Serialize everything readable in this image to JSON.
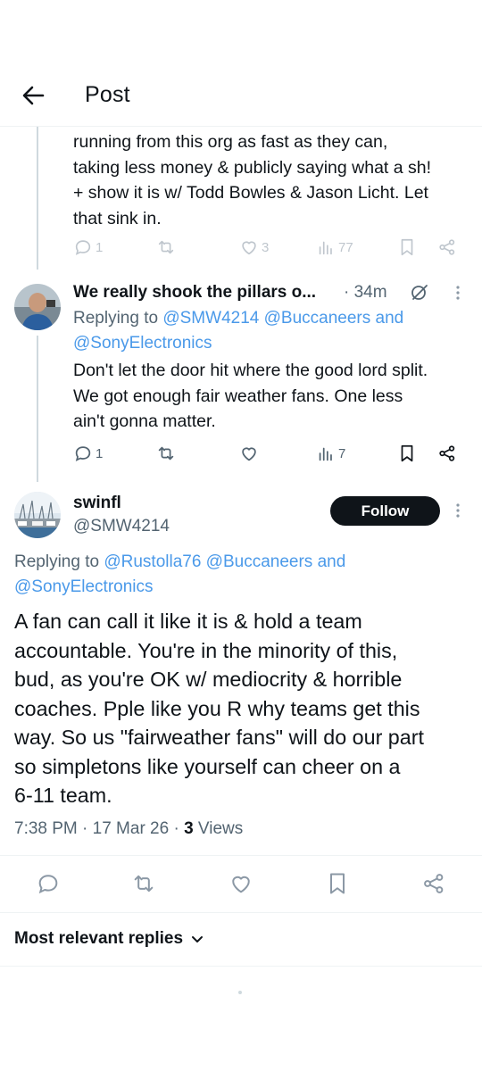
{
  "header": {
    "title": "Post"
  },
  "prev_tweet": {
    "text_lines": [
      "running from this org as fast as they can,",
      "taking less money & publicly saying what a sh!",
      "+ show it is w/ Todd Bowles & Jason Licht. Let",
      "that sink in."
    ],
    "replies": "1",
    "likes": "3",
    "views": "77"
  },
  "reply_tweet": {
    "name": "We really shook the pillars o...",
    "time": "· 34m",
    "replying_prefix": "Replying to ",
    "replying_line1_mentions": "@SMW4214 @Buccaneers and",
    "replying_line2_mentions": "@SonyElectronics",
    "text_lines": [
      "Don't let the door hit where the good lord split.",
      "We got enough fair weather fans. One less",
      "ain't gonna matter."
    ],
    "replies": "1",
    "views": "7"
  },
  "main_tweet": {
    "name": "swinfl",
    "handle": "@SMW4214",
    "follow_label": "Follow",
    "replying_prefix": "Replying to ",
    "replying_line1_mentions": "@Rustolla76 @Buccaneers and",
    "replying_line2_mentions": "@SonyElectronics",
    "text_lines": [
      "A fan can call it like it is & hold a team",
      "accountable.  You're in the minority of this,",
      "bud, as you're OK w/ mediocrity & horrible",
      "coaches.  Pple like you R why teams get this",
      "way. So us \"fairweather fans\" will do our part",
      "so simpletons like yourself can cheer on a",
      "6-11 team."
    ],
    "timestamp": "7:38 PM · 17 Mar 26 · ",
    "views_count": "3",
    "views_label": " Views"
  },
  "replies_sort": {
    "label": "Most relevant replies"
  },
  "colors": {
    "link": "#4a99e9",
    "muted": "#536471",
    "icon": "#8b98a5"
  }
}
